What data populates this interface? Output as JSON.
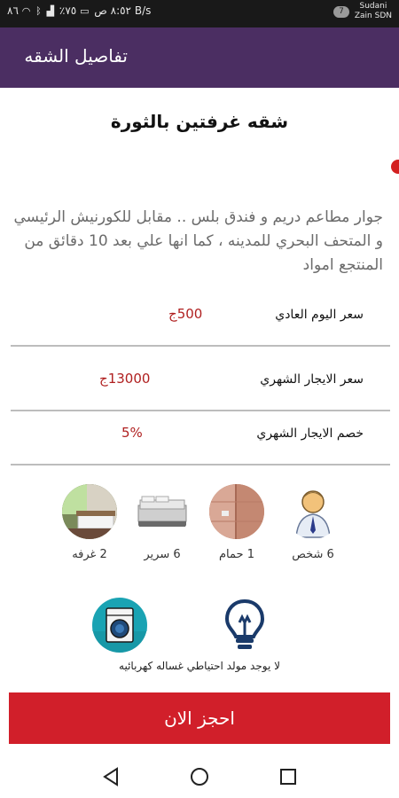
{
  "status_bar": {
    "time": "٨:٥٢ ص",
    "speed": "٨٦ B/s",
    "battery": "٧٥٪",
    "carrier_badge": "7",
    "carrier_name_line1": "Sudani",
    "carrier_name_line2": "Zain SDN"
  },
  "app_bar": {
    "title": "تفاصيل الشقه",
    "background": "#4b2e62"
  },
  "listing": {
    "title": "شقه غرفتين بالثورة",
    "description": "جوار مطاعم دريم و فندق بلس .. مقابل للكورنيش الرئيسي و المتحف البحري للمدينه ، كما انها علي بعد 10 دقائق من  المنتجع امواد"
  },
  "pricing": {
    "daily": {
      "label": "سعر اليوم العادي",
      "value": "500ج"
    },
    "monthly": {
      "label": "سعر الايجار الشهري",
      "value": "13000ج"
    },
    "discount": {
      "label": "خصم الايجار الشهري",
      "value": "5%"
    },
    "value_color": "#b02020"
  },
  "amenities": [
    {
      "icon": "person-icon",
      "label": "6 شخص"
    },
    {
      "icon": "bathroom-icon",
      "label": "1 حمام"
    },
    {
      "icon": "bed-icon",
      "label": "6 سرير"
    },
    {
      "icon": "room-icon",
      "label": "2  غرفه"
    }
  ],
  "utilities": {
    "icons": [
      "lightbulb-icon",
      "washing-machine-icon"
    ],
    "text": "لا يوجد مولد احتياطي غساله كهربائيه"
  },
  "book_button": {
    "label": "احجز الان",
    "color": "#d11f2a"
  },
  "nav_bar": {
    "icons": [
      "back-icon",
      "home-icon",
      "recents-icon"
    ]
  }
}
